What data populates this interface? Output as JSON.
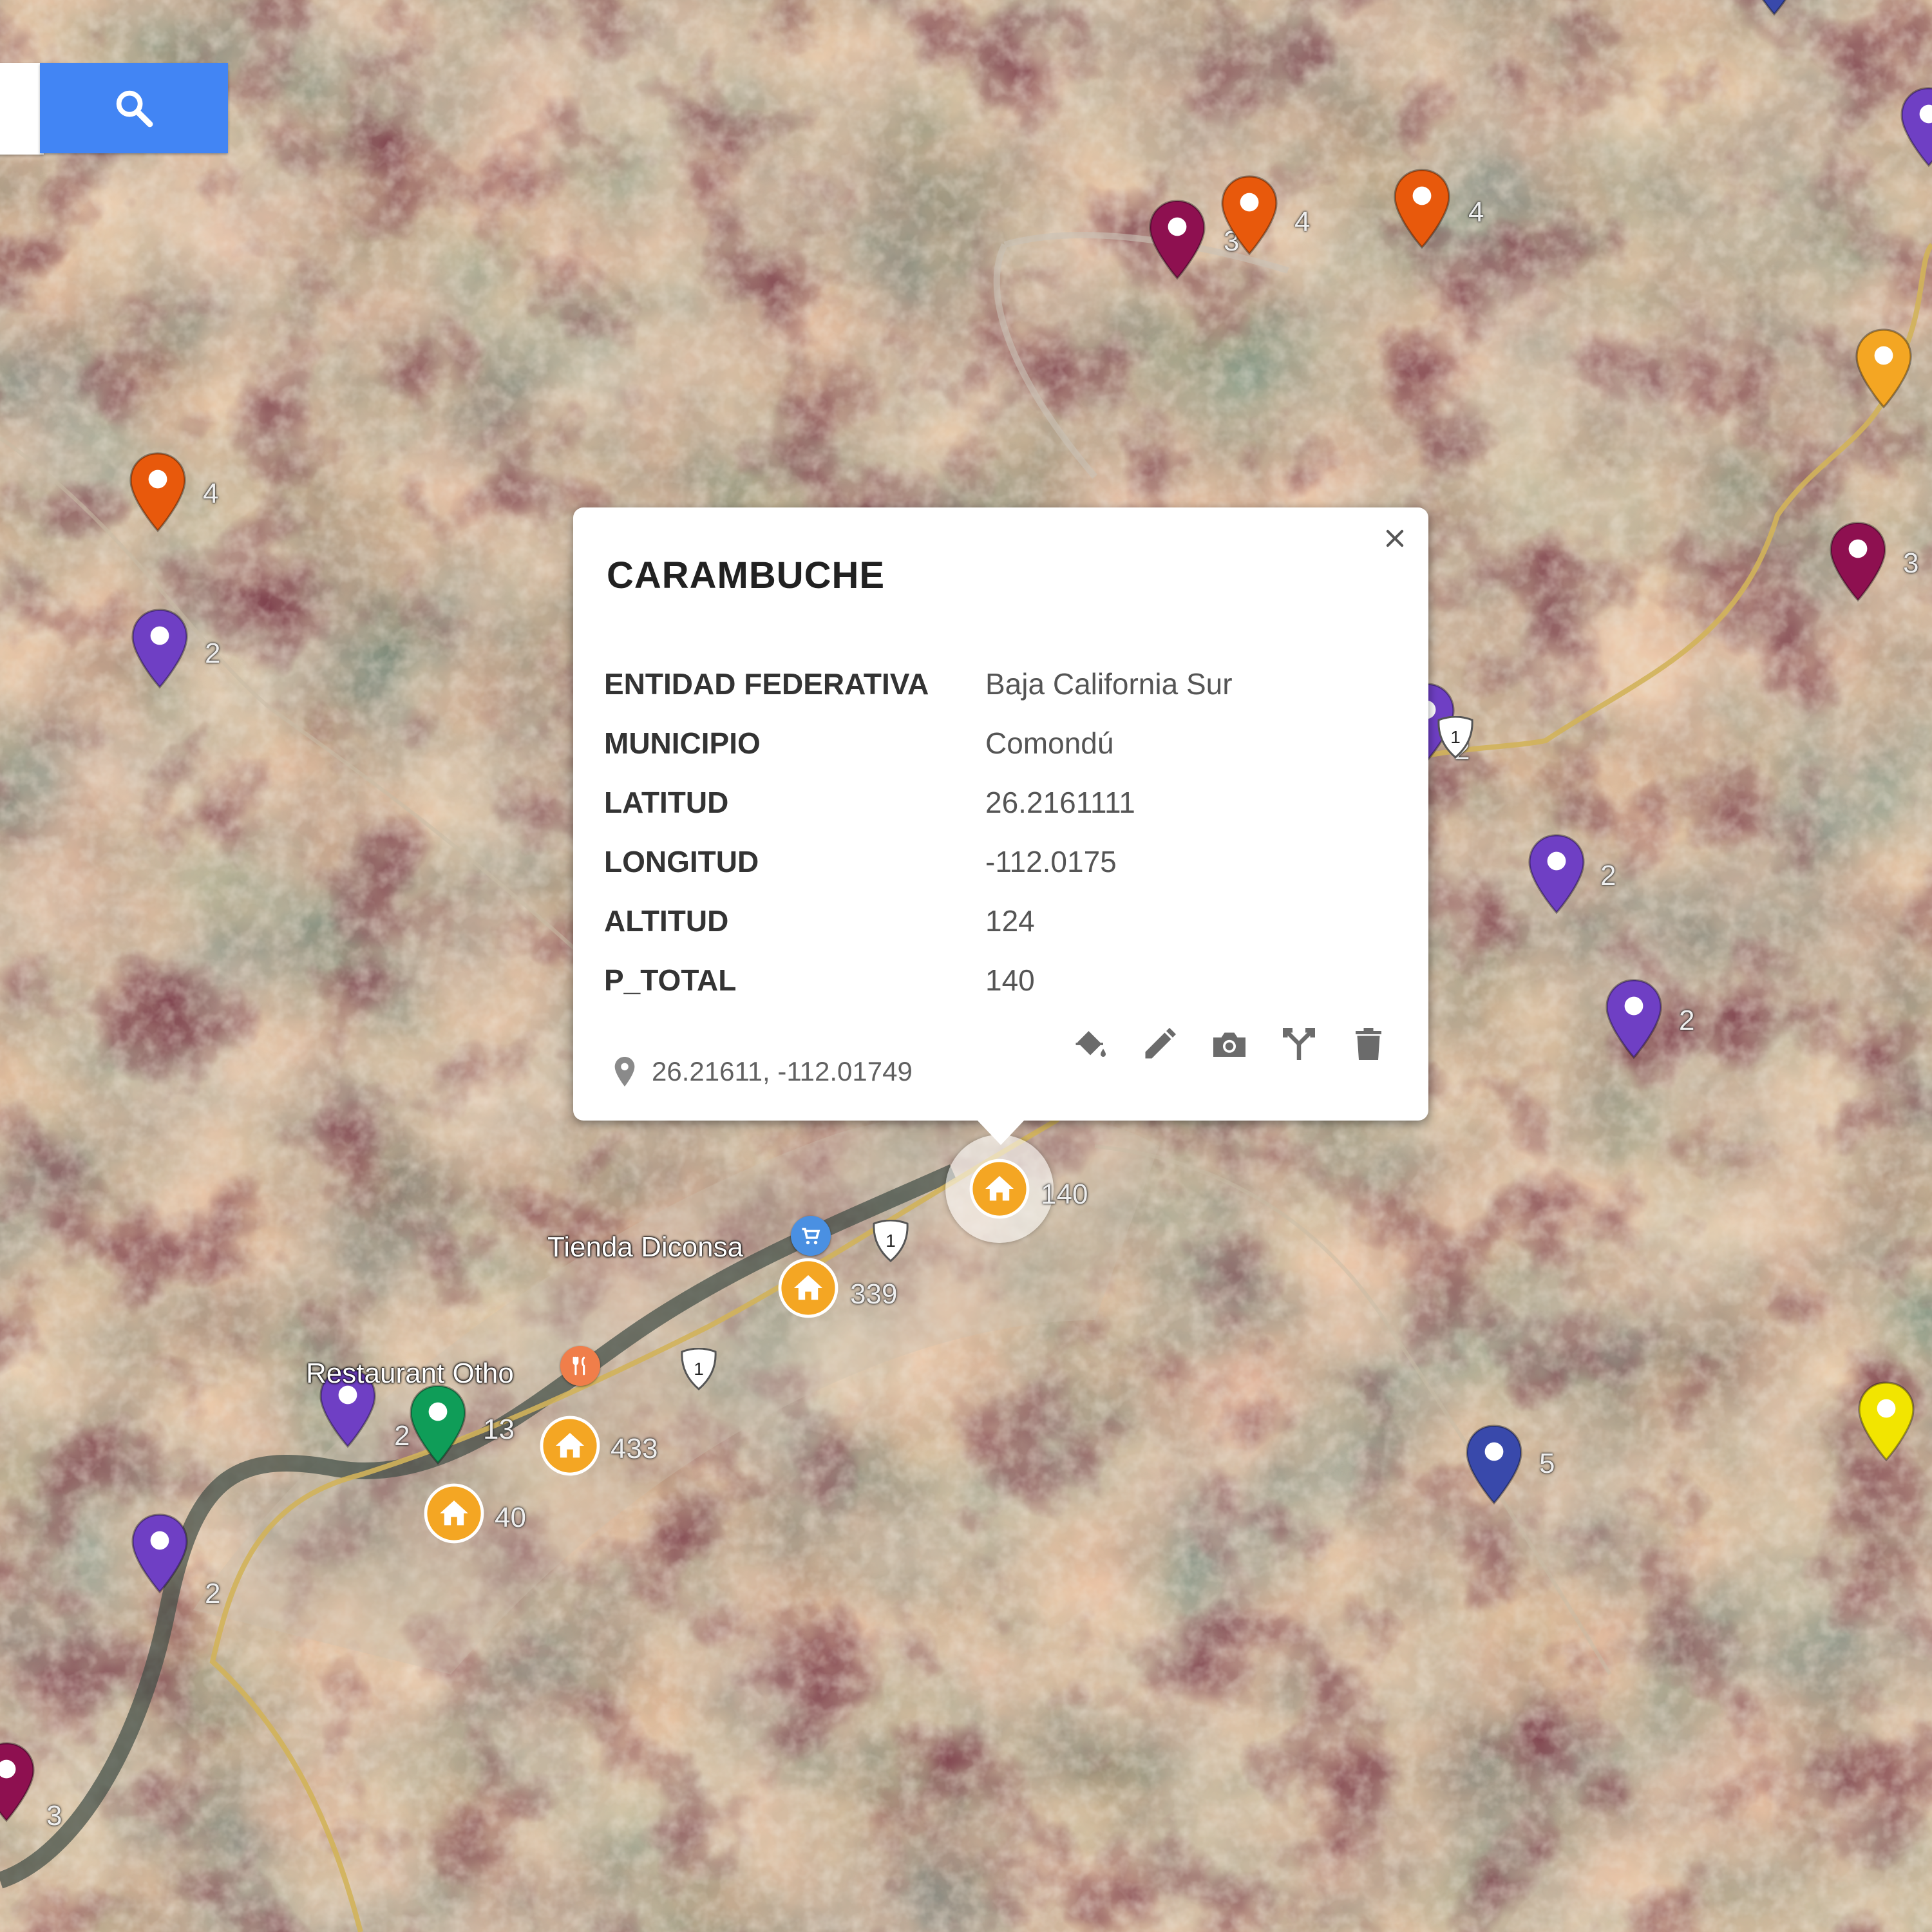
{
  "search": {
    "button_icon": "search-icon",
    "button_color": "#4285f4"
  },
  "popup": {
    "title": "CARAMBUCHE",
    "attributes": [
      {
        "key": "ENTIDAD FEDERATIVA",
        "value": "Baja California Sur"
      },
      {
        "key": "MUNICIPIO",
        "value": "Comondú"
      },
      {
        "key": "LATITUD",
        "value": "26.2161111"
      },
      {
        "key": "LONGITUD",
        "value": "-112.0175"
      },
      {
        "key": "ALTITUD",
        "value": "124"
      },
      {
        "key": "P_TOTAL",
        "value": "140"
      }
    ],
    "coordinates": "26.21611, -112.01749",
    "tools": [
      "paint-bucket-icon",
      "pencil-icon",
      "camera-icon",
      "directions-icon",
      "trash-icon"
    ]
  },
  "map": {
    "marker_colors": {
      "orange": "#e8590c",
      "purple": "#6f3fc4",
      "maroon": "#8e1050",
      "green": "#0f9d58",
      "blue": "#3949ab",
      "amber": "#f4a623",
      "yellow": "#f2e500"
    },
    "pin_markers": [
      {
        "color": "maroon",
        "label": "3"
      },
      {
        "color": "orange",
        "label": "4"
      },
      {
        "color": "orange",
        "label": "4"
      },
      {
        "color": "orange",
        "label": "4"
      },
      {
        "color": "purple",
        "label": "2"
      },
      {
        "color": "maroon",
        "label": "3"
      },
      {
        "color": "purple",
        "label": "2"
      },
      {
        "color": "purple",
        "label": "2"
      },
      {
        "color": "purple",
        "label": "2"
      },
      {
        "color": "green",
        "label": "13"
      },
      {
        "color": "purple",
        "label": "2"
      },
      {
        "color": "blue",
        "label": "5"
      },
      {
        "color": "maroon",
        "label": "3"
      },
      {
        "color": "amber",
        "label": ""
      },
      {
        "color": "yellow",
        "label": ""
      },
      {
        "color": "blue",
        "label": ""
      },
      {
        "color": "purple",
        "label": ""
      },
      {
        "color": "purple",
        "label": "2"
      }
    ],
    "house_markers": [
      {
        "label": "140",
        "selected": true
      },
      {
        "label": "339"
      },
      {
        "label": "433"
      },
      {
        "label": "40"
      }
    ],
    "places": [
      {
        "name": "Tienda Diconsa",
        "icon": "shopping-cart-icon"
      },
      {
        "name": "Restaurant Otho",
        "icon": "restaurant-icon"
      }
    ],
    "route_shields": [
      "1",
      "1",
      "1"
    ]
  }
}
